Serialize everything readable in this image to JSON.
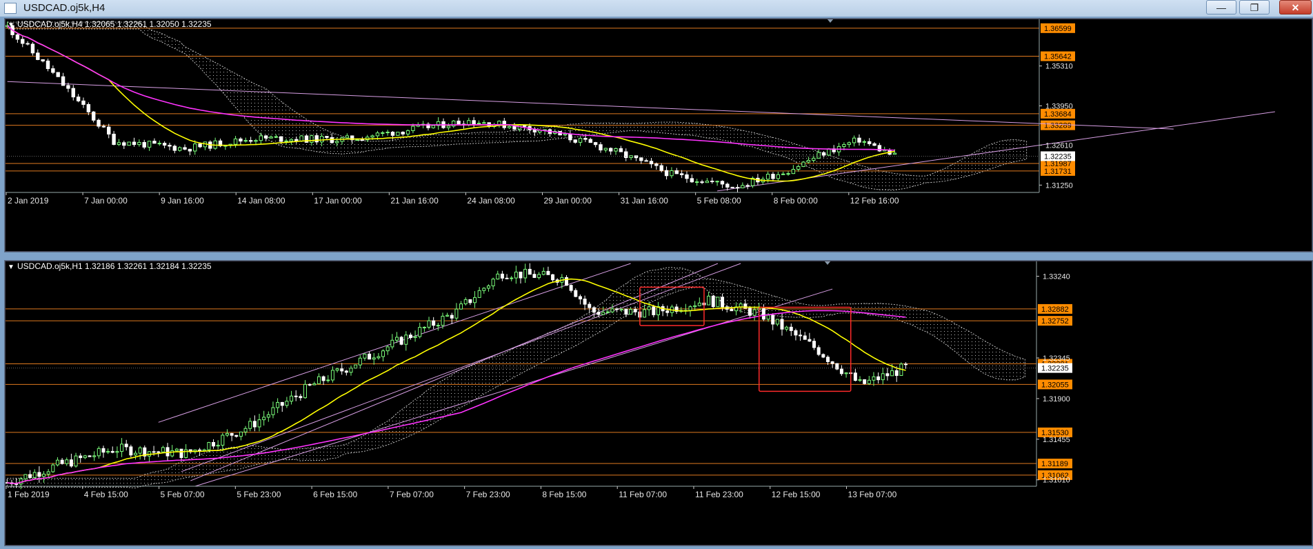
{
  "window": {
    "title": "USDCAD.oj5k,H4",
    "buttons": {
      "minimize": "—",
      "maximize": "❐",
      "close": "✕"
    }
  },
  "colors": {
    "background": "#000000",
    "bull_candle": "#7cff7c",
    "bear_candle": "#ffffff",
    "ma_fast": "#ffff00",
    "ma_slow": "#ff33ff",
    "hline": "#e07a1f",
    "price_badge_bg": "#ff8c00",
    "current_badge_bg": "#ffffff",
    "box": "#ff2a2a",
    "channel": "#d9a0e6",
    "ichimoku_cloud": "#bfbfbf"
  },
  "charts": [
    {
      "id": "h4",
      "header": "USDCAD.oj5k,H4  1.32065 1.32261 1.32050 1.32235",
      "dropdown_glyph": "▼",
      "ylim": [
        1.31,
        1.3683
      ],
      "price_ticks": [
        "1.35310",
        "1.33950",
        "1.32610",
        "1.31250"
      ],
      "horizontal_levels": [
        "1.36599",
        "1.35642",
        "1.33684",
        "1.33289",
        "1.31987",
        "1.31731"
      ],
      "current_price": "1.32235",
      "time_labels": [
        "2 Jan 2019",
        "7 Jan 00:00",
        "9 Jan 16:00",
        "14 Jan 08:00",
        "17 Jan 00:00",
        "21 Jan 16:00",
        "24 Jan 08:00",
        "29 Jan 00:00",
        "31 Jan 16:00",
        "5 Feb 08:00",
        "8 Feb 00:00",
        "12 Feb 16:00"
      ],
      "trend_lines": [
        {
          "p1": [
            0,
            1.3478
          ],
          "p2": [
            230,
            1.3316
          ]
        },
        {
          "p1": [
            140,
            1.3105
          ],
          "p2": [
            250,
            1.3375
          ]
        }
      ],
      "boxes": []
    },
    {
      "id": "h1",
      "header": "USDCAD.oj5k,H1  1.32186 1.32261 1.32184 1.32235",
      "dropdown_glyph": "▼",
      "ylim": [
        1.3094,
        1.3338
      ],
      "price_ticks": [
        "1.33240",
        "1.32345",
        "1.31900",
        "1.31455",
        "1.31010"
      ],
      "horizontal_levels": [
        "1.32882",
        "1.32752",
        "1.32281",
        "1.32055",
        "1.31530",
        "1.31189",
        "1.31062"
      ],
      "current_price": "1.32235",
      "time_labels": [
        "1 Feb 2019",
        "4 Feb 15:00",
        "5 Feb 07:00",
        "5 Feb 23:00",
        "6 Feb 15:00",
        "7 Feb 07:00",
        "7 Feb 23:00",
        "8 Feb 15:00",
        "11 Feb 07:00",
        "11 Feb 23:00",
        "12 Feb 15:00",
        "13 Feb 07:00"
      ],
      "trend_lines": [
        {
          "p1": [
            33,
            1.3164
          ],
          "p2": [
            136,
            1.3338
          ]
        },
        {
          "p1": [
            40,
            1.31
          ],
          "p2": [
            155,
            1.3338
          ]
        },
        {
          "p1": [
            38,
            1.311
          ],
          "p2": [
            160,
            1.3338
          ]
        },
        {
          "p1": [
            41,
            1.3094
          ],
          "p2": [
            180,
            1.331
          ]
        }
      ],
      "boxes": [
        {
          "label": "consolidation-box",
          "i0": 138,
          "i1": 152,
          "p_top": 1.3312,
          "p_bottom": 1.327
        },
        {
          "label": "decline-box",
          "i0": 164,
          "i1": 184,
          "p_top": 1.329,
          "p_bottom": 1.3198
        }
      ]
    }
  ]
}
